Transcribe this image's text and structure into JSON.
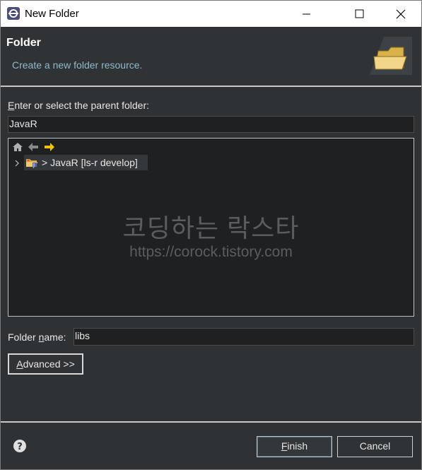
{
  "window": {
    "title": "New Folder",
    "minimize_icon": "minimize-icon",
    "maximize_icon": "maximize-icon",
    "close_icon": "close-icon"
  },
  "header": {
    "title": "Folder",
    "description": "Create a new folder resource."
  },
  "parent": {
    "label_prefix": "",
    "label_mnemonic": "E",
    "label_rest": "nter or select the parent folder:",
    "value": "JavaR"
  },
  "tree": {
    "nav_icons": [
      "home-icon",
      "back-arrow-icon",
      "forward-arrow-icon"
    ],
    "node_label": "> JavaR [ls-r develop]",
    "watermark_title": "코딩하는 락스타",
    "watermark_url": "https://corock.tistory.com"
  },
  "folder_name": {
    "label_prefix": "Folder ",
    "label_mnemonic": "n",
    "label_rest": "ame:",
    "value": "libs"
  },
  "buttons": {
    "advanced_mnemonic": "A",
    "advanced_rest": "dvanced >>",
    "finish_mnemonic": "F",
    "finish_rest": "inish",
    "cancel": "Cancel"
  },
  "colors": {
    "accent_text": "#8fb9c9",
    "background": "#2f3234",
    "field_background": "#1e2021",
    "forward_arrow": "#f5c400"
  }
}
